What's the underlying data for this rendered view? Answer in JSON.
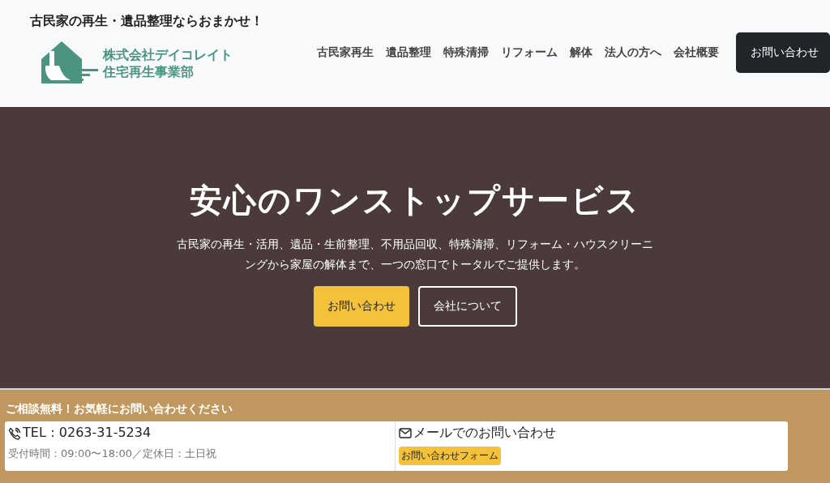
{
  "header": {
    "tagline": "古民家の再生・遺品整理ならおまかせ！",
    "logo": {
      "line1": "株式会社デイコレイト",
      "line2": "住宅再生事業部"
    },
    "nav": [
      "古民家再生",
      "遺品整理",
      "特殊清掃",
      "リフォーム",
      "解体",
      "法人の方へ",
      "会社概要"
    ],
    "contact_button": "お問い合わせ"
  },
  "hero": {
    "title": "安心のワンストップサービス",
    "lead": "古民家の再生・活用、遺品・生前整理、不用品回収、特殊清掃、リフォーム・ハウスクリーニングから家屋の解体まで、一つの窓口でトータルでご提供します。",
    "buttons": [
      {
        "label": "お問い合わせ",
        "kind": "primary"
      },
      {
        "label": "会社について",
        "kind": "outline"
      }
    ]
  },
  "contact_bar": {
    "heading": "ご相談無料！お気軽にお問い合わせください",
    "phone": "TEL：0263-31-5234",
    "hours": "受付時間：09:00〜18:00／定休日：土日祝",
    "mail_heading": "メールでのお問い合わせ",
    "form_button": "お問い合わせフォーム"
  }
}
